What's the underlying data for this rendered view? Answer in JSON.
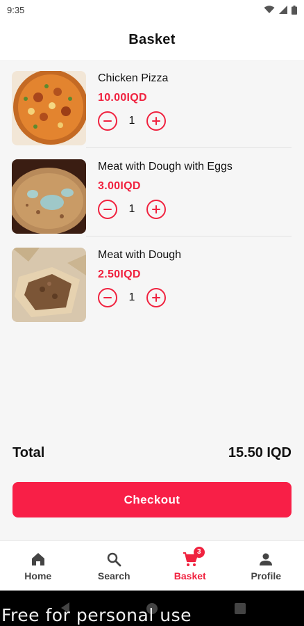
{
  "status_bar": {
    "time": "9:35"
  },
  "header": {
    "title": "Basket"
  },
  "items": [
    {
      "name": "Chicken Pizza",
      "price": "10.00IQD",
      "quantity": "1"
    },
    {
      "name": "Meat with Dough with Eggs",
      "price": "3.00IQD",
      "quantity": "1"
    },
    {
      "name": "Meat with Dough",
      "price": "2.50IQD",
      "quantity": "1"
    }
  ],
  "total": {
    "label": "Total",
    "value": "15.50 IQD"
  },
  "checkout": {
    "label": "Checkout"
  },
  "bottom_nav": [
    {
      "label": "Home",
      "icon": "home-icon"
    },
    {
      "label": "Search",
      "icon": "search-icon"
    },
    {
      "label": "Basket",
      "icon": "cart-icon",
      "badge": "3",
      "active": true
    },
    {
      "label": "Profile",
      "icon": "person-icon"
    }
  ],
  "colors": {
    "accent": "#f0223f",
    "button": "#f81f47"
  },
  "watermark": "Free for personal use"
}
